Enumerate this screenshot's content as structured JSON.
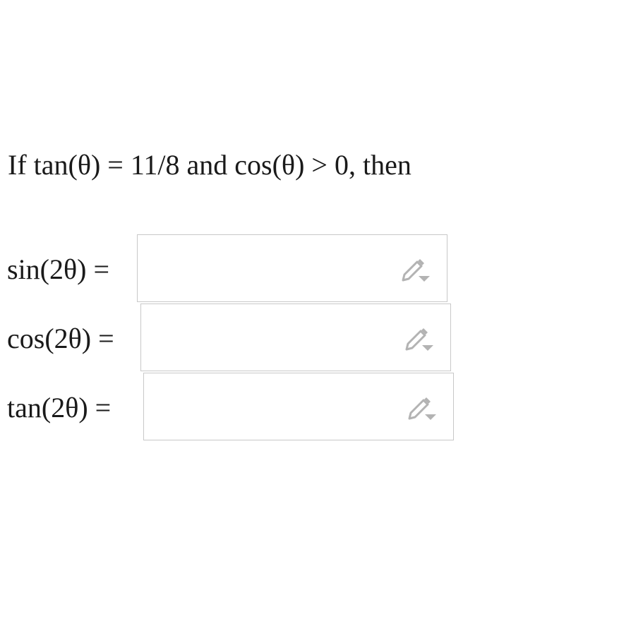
{
  "question": {
    "lead": "If ",
    "given_1": "tan(θ) = 11/8",
    "conj": " and ",
    "given_2": "cos(θ) > 0",
    "tail": ", then"
  },
  "answers": [
    {
      "label": "sin(2θ) =",
      "value": ""
    },
    {
      "label": "cos(2θ) =",
      "value": ""
    },
    {
      "label": "tan(2θ) =",
      "value": ""
    }
  ],
  "icons": {
    "answer_edit": "pencil-dropdown-icon"
  },
  "colors": {
    "box_border": "#c8c8c8",
    "icon": "#b3b3b3",
    "text": "#1a1a1a"
  }
}
